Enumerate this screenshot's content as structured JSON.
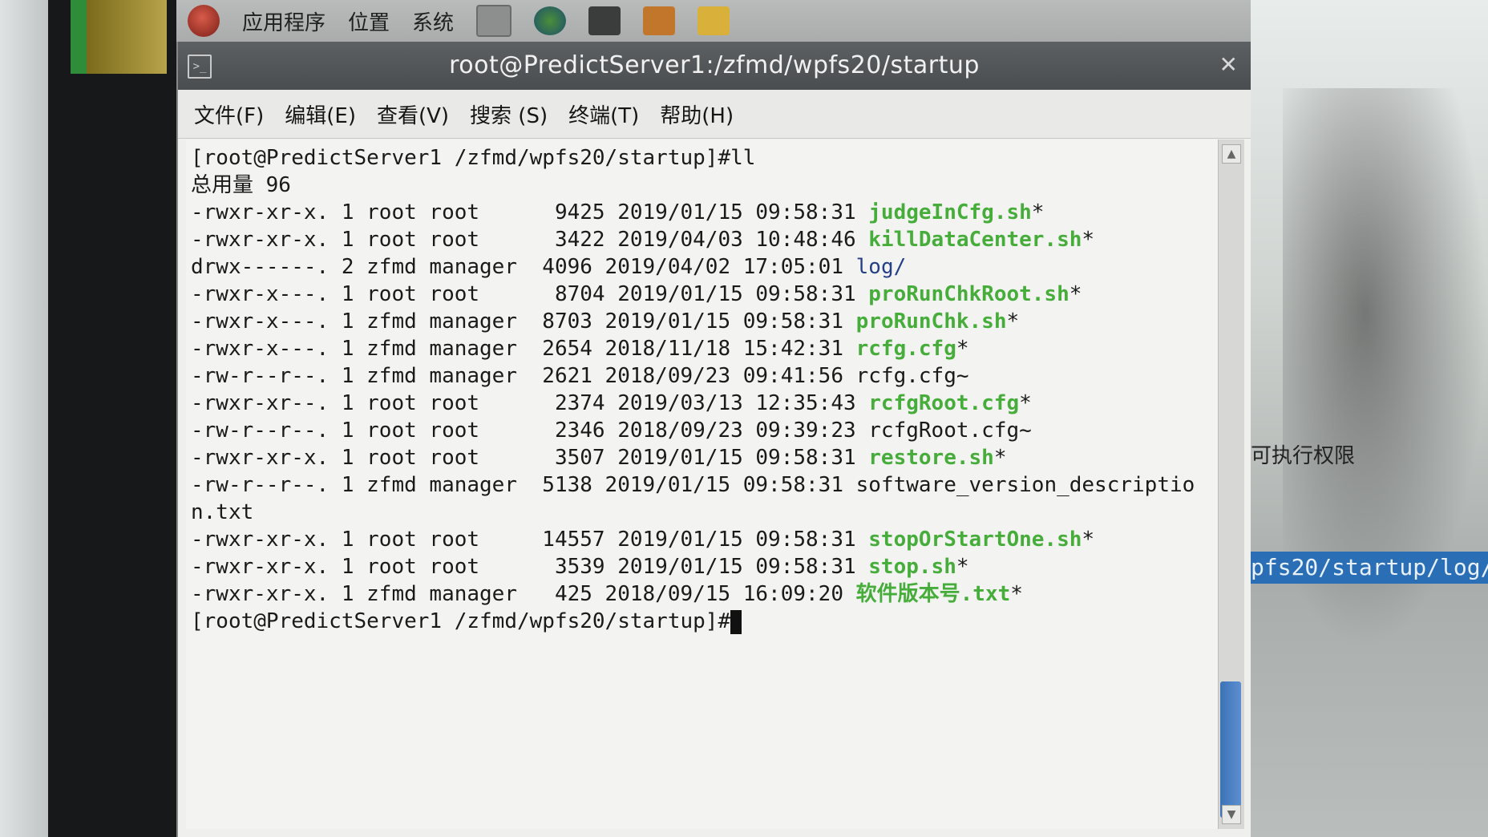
{
  "panel": {
    "menus": [
      "应用程序",
      "位置",
      "系统"
    ]
  },
  "window": {
    "title": "root@PredictServer1:/zfmd/wpfs20/startup",
    "menus": [
      "文件(F)",
      "编辑(E)",
      "查看(V)",
      "搜索 (S)",
      "终端(T)",
      "帮助(H)"
    ]
  },
  "terminal": {
    "prompt_cmd": "[root@PredictServer1 /zfmd/wpfs20/startup]#ll",
    "total": "总用量 96",
    "rows": [
      {
        "meta": "-rwxr-xr-x. 1 root root      9425 2019/01/15 09:58:31 ",
        "name": "judgeInCfg.sh",
        "suffix": "*",
        "style": "g"
      },
      {
        "meta": "-rwxr-xr-x. 1 root root      3422 2019/04/03 10:48:46 ",
        "name": "killDataCenter.sh",
        "suffix": "*",
        "style": "g"
      },
      {
        "meta": "drwx------. 2 zfmd manager  4096 2019/04/02 17:05:01 ",
        "name": "log",
        "suffix": "/",
        "style": "blue"
      },
      {
        "meta": "-rwxr-x---. 1 root root      8704 2019/01/15 09:58:31 ",
        "name": "proRunChkRoot.sh",
        "suffix": "*",
        "style": "g"
      },
      {
        "meta": "-rwxr-x---. 1 zfmd manager  8703 2019/01/15 09:58:31 ",
        "name": "proRunChk.sh",
        "suffix": "*",
        "style": "g"
      },
      {
        "meta": "-rwxr-x---. 1 zfmd manager  2654 2018/11/18 15:42:31 ",
        "name": "rcfg.cfg",
        "suffix": "*",
        "style": "g"
      },
      {
        "meta": "-rw-r--r--. 1 zfmd manager  2621 2018/09/23 09:41:56 ",
        "name": "rcfg.cfg~",
        "suffix": "",
        "style": ""
      },
      {
        "meta": "-rwxr-xr--. 1 root root      2374 2019/03/13 12:35:43 ",
        "name": "rcfgRoot.cfg",
        "suffix": "*",
        "style": "g"
      },
      {
        "meta": "-rw-r--r--. 1 root root      2346 2018/09/23 09:39:23 ",
        "name": "rcfgRoot.cfg~",
        "suffix": "",
        "style": ""
      },
      {
        "meta": "-rwxr-xr-x. 1 root root      3507 2019/01/15 09:58:31 ",
        "name": "restore.sh",
        "suffix": "*",
        "style": "g"
      },
      {
        "meta": "-rw-r--r--. 1 zfmd manager  5138 2019/01/15 09:58:31 ",
        "name": "software_version_descriptio",
        "suffix": "",
        "style": ""
      },
      {
        "meta": "",
        "name": "n.txt",
        "suffix": "",
        "style": ""
      },
      {
        "meta": "-rwxr-xr-x. 1 root root     14557 2019/01/15 09:58:31 ",
        "name": "stopOrStartOne.sh",
        "suffix": "*",
        "style": "g"
      },
      {
        "meta": "-rwxr-xr-x. 1 root root      3539 2019/01/15 09:58:31 ",
        "name": "stop.sh",
        "suffix": "*",
        "style": "g"
      },
      {
        "meta": "-rwxr-xr-x. 1 zfmd manager   425 2018/09/15 16:09:20 ",
        "name": "软件版本号.txt",
        "suffix": "*",
        "style": "g"
      }
    ],
    "prompt_end": "[root@PredictServer1 /zfmd/wpfs20/startup]#"
  },
  "background": {
    "right_text": "可执行权限",
    "right_selection": "pfs20/startup/log/"
  },
  "colors": {
    "exec_green": "#46ad3a",
    "dir_blue": "#243f86",
    "titlebar": "#4a4d50",
    "scroll_thumb": "#3d72b8"
  }
}
